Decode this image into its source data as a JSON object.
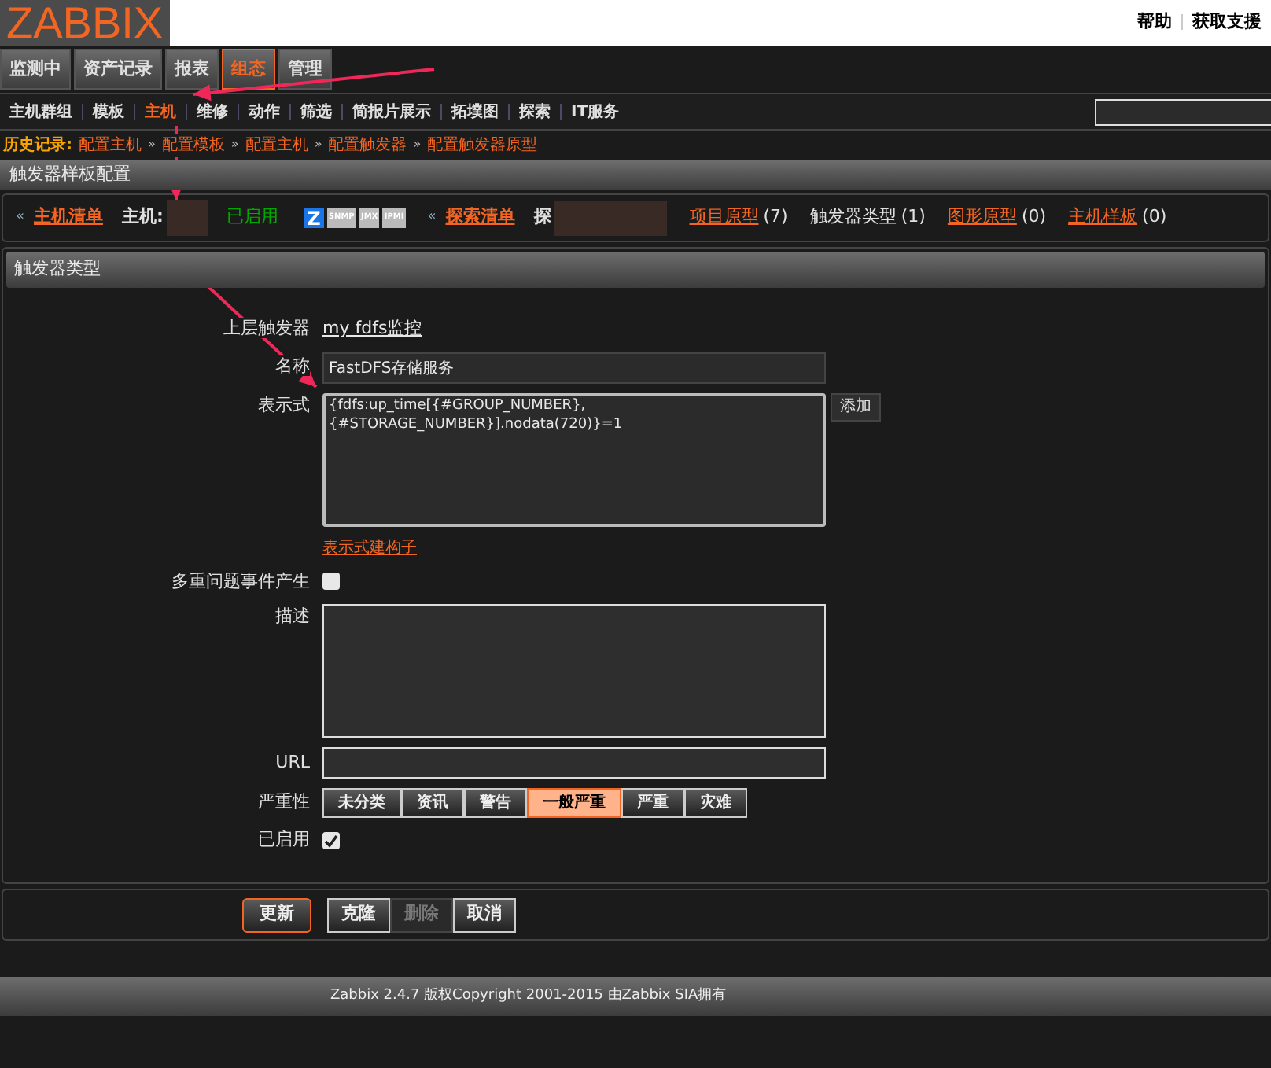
{
  "logo": "ZABBIX",
  "top_links": [
    "帮助",
    "获取支援"
  ],
  "main_menu": [
    {
      "label": "监测中",
      "selected": false
    },
    {
      "label": "资产记录",
      "selected": false
    },
    {
      "label": "报表",
      "selected": false
    },
    {
      "label": "组态",
      "selected": true
    },
    {
      "label": "管理",
      "selected": false
    }
  ],
  "sub_menu": [
    {
      "label": "主机群组",
      "selected": false
    },
    {
      "label": "模板",
      "selected": false
    },
    {
      "label": "主机",
      "selected": true
    },
    {
      "label": "维修",
      "selected": false
    },
    {
      "label": "动作",
      "selected": false
    },
    {
      "label": "筛选",
      "selected": false
    },
    {
      "label": "简报片展示",
      "selected": false
    },
    {
      "label": "拓墣图",
      "selected": false
    },
    {
      "label": "探索",
      "selected": false
    },
    {
      "label": "IT服务",
      "selected": false
    }
  ],
  "history": {
    "label": "历史记录:",
    "separator": "»",
    "items": [
      "配置主机",
      "配置模板",
      "配置主机",
      "配置触发器",
      "配置触发器原型"
    ]
  },
  "page_title": "触发器样板配置",
  "host_nav": {
    "back_marker": "«",
    "host_list": "主机清单",
    "host_label": "主机:",
    "status": "已启用",
    "badges": [
      {
        "label": "Z",
        "on": true
      },
      {
        "label": "SNMP",
        "on": false
      },
      {
        "label": "JMX",
        "on": false
      },
      {
        "label": "IPMI",
        "on": false
      }
    ],
    "discovery_marker": "«",
    "discovery_list": "探索清单",
    "discovery_label": "探",
    "links": [
      {
        "label": "项目原型",
        "count": "(7)",
        "kind": "link"
      },
      {
        "label": "触发器类型",
        "count": "(1)",
        "kind": "current"
      },
      {
        "label": "图形原型",
        "count": "(0)",
        "kind": "link"
      },
      {
        "label": "主机样板",
        "count": "(0)",
        "kind": "link"
      }
    ]
  },
  "form": {
    "title": "触发器类型",
    "parent_label": "上层触发器",
    "parent_value": "my fdfs监控",
    "name_label": "名称",
    "name_value": "FastDFS存储服务",
    "expression_label": "表示式",
    "expression_value": "{fdfs:up_time[{#GROUP_NUMBER},\n{#STORAGE_NUMBER}].nodata(720)}=1",
    "add_button": "添加",
    "constructor_link": "表示式建构子",
    "multiple_label": "多重问题事件产生",
    "multiple_checked": false,
    "description_label": "描述",
    "url_label": "URL",
    "severity_label": "严重性",
    "severities": [
      {
        "label": "未分类",
        "selected": false
      },
      {
        "label": "资讯",
        "selected": false
      },
      {
        "label": "警告",
        "selected": false
      },
      {
        "label": "一般严重",
        "selected": true
      },
      {
        "label": "严重",
        "selected": false
      },
      {
        "label": "灾难",
        "selected": false
      }
    ],
    "enabled_label": "已启用",
    "enabled_checked": true
  },
  "buttons": [
    {
      "label": "更新",
      "kind": "primary",
      "disabled": false
    },
    {
      "label": "克隆",
      "kind": "group",
      "disabled": false
    },
    {
      "label": "删除",
      "kind": "group",
      "disabled": true
    },
    {
      "label": "取消",
      "kind": "group",
      "disabled": false
    }
  ],
  "footer": "Zabbix 2.4.7 版权Copyright 2001-2015 由Zabbix SIA拥有"
}
